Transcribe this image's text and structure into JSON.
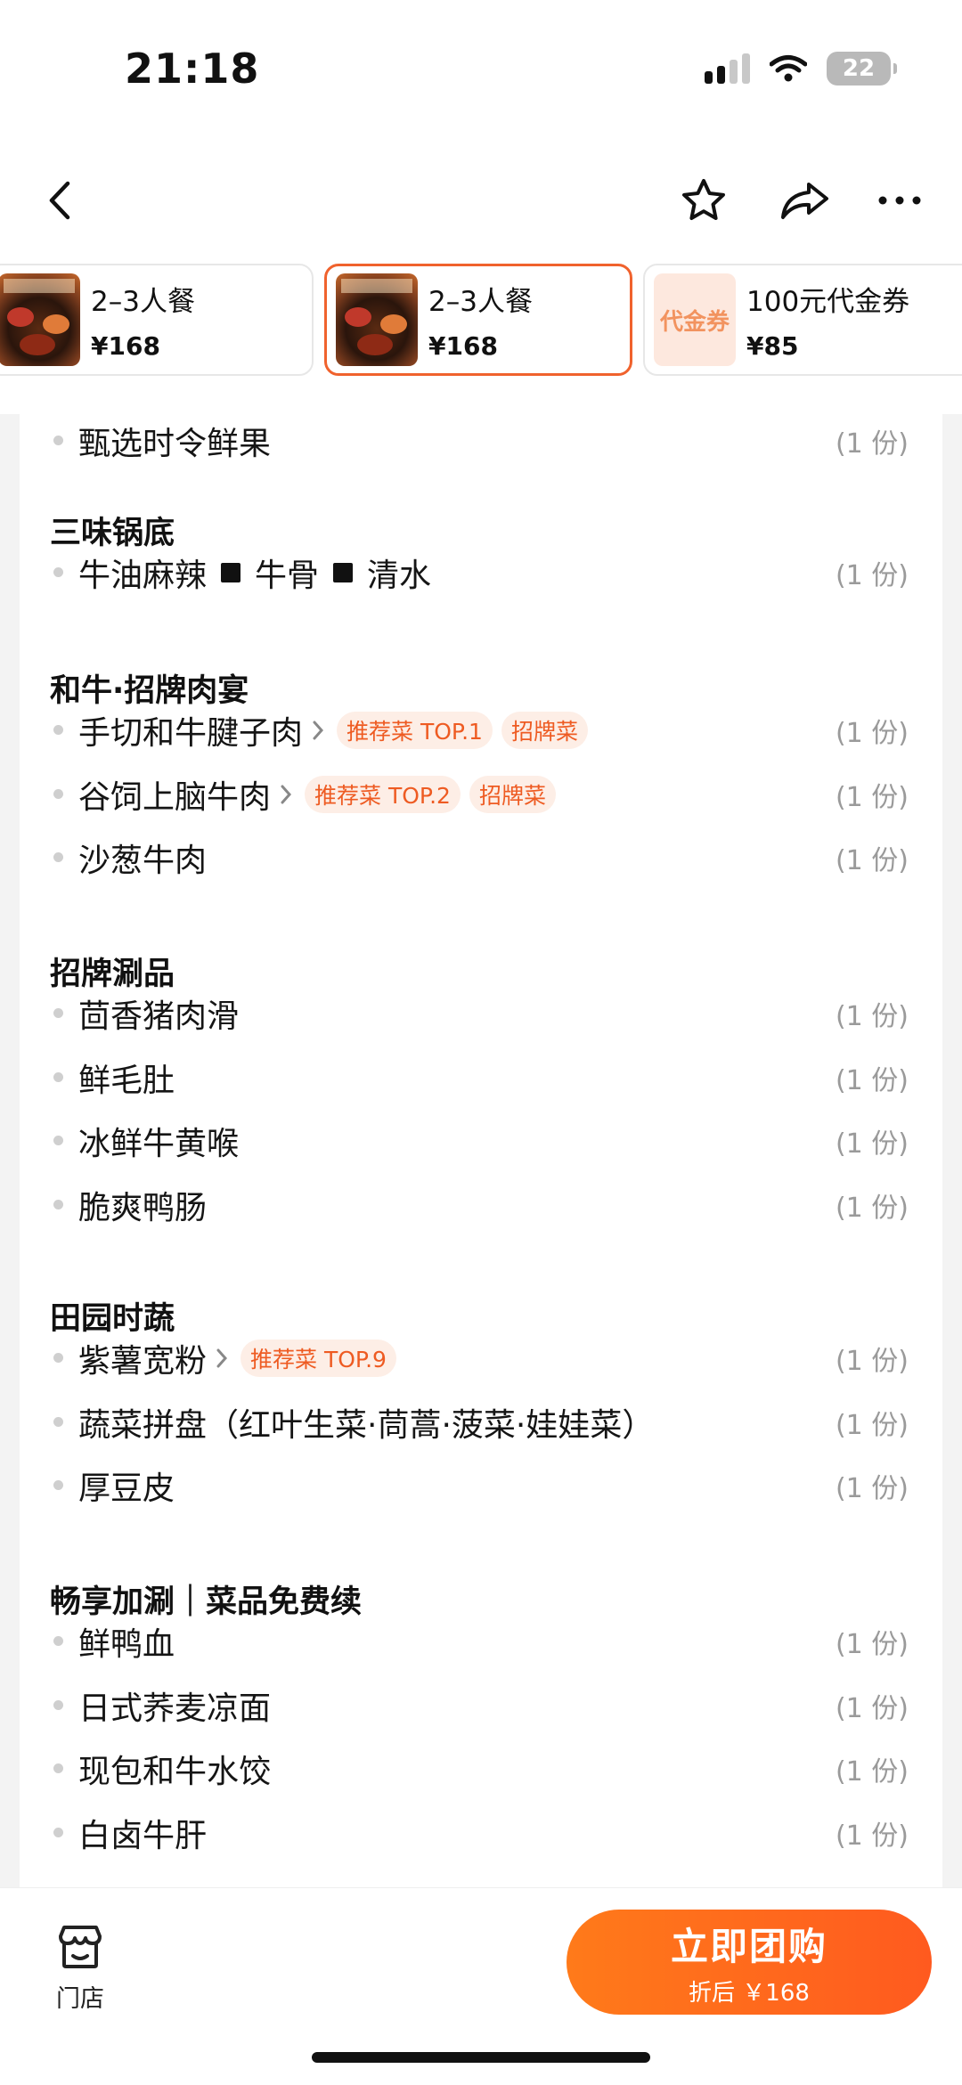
{
  "status_bar": {
    "time": "21:18",
    "battery": "22"
  },
  "nav": {
    "back": "back",
    "favorite": "star",
    "share": "share",
    "more": "more"
  },
  "packages": [
    {
      "name": "2–3人餐",
      "price": "¥168",
      "thumb": "hotpot-photo"
    },
    {
      "name": "2–3人餐",
      "price": "¥168",
      "thumb": "hotpot-photo",
      "active": true
    },
    {
      "name": "100元代金券",
      "price": "¥85",
      "thumb_text": "代金券"
    }
  ],
  "menu": {
    "top_item": {
      "name": "甄选时令鲜果",
      "qty": "(1 份)"
    },
    "sections": [
      {
        "title": "三味锅底",
        "items": [
          {
            "parts": [
              "牛油麻辣",
              "牛骨",
              "清水"
            ],
            "qty": "(1 份)"
          }
        ]
      },
      {
        "title": "和牛·招牌肉宴",
        "items": [
          {
            "name": "手切和牛腱子肉",
            "tags": [
              "推荐菜 TOP.1",
              "招牌菜"
            ],
            "qty": "(1 份)"
          },
          {
            "name": "谷饲上脑牛肉",
            "tags": [
              "推荐菜 TOP.2",
              "招牌菜"
            ],
            "qty": "(1 份)"
          },
          {
            "name": "沙葱牛肉",
            "qty": "(1 份)"
          }
        ]
      },
      {
        "title": "招牌涮品",
        "items": [
          {
            "name": "茴香猪肉滑",
            "qty": "(1 份)"
          },
          {
            "name": "鲜毛肚",
            "qty": "(1 份)"
          },
          {
            "name": "冰鲜牛黄喉",
            "qty": "(1 份)"
          },
          {
            "name": "脆爽鸭肠",
            "qty": "(1 份)"
          }
        ]
      },
      {
        "title": "田园时蔬",
        "items": [
          {
            "name": "紫薯宽粉",
            "tags": [
              "推荐菜 TOP.9"
            ],
            "qty": "(1 份)"
          },
          {
            "name": "蔬菜拼盘（红叶生菜·茼蒿·菠菜·娃娃菜）",
            "qty": "(1 份)"
          },
          {
            "name": "厚豆皮",
            "qty": "(1 份)"
          }
        ]
      },
      {
        "title": "畅享加涮｜菜品免费续",
        "items": [
          {
            "name": "鲜鸭血",
            "qty": "(1 份)"
          },
          {
            "name": "日式荞麦凉面",
            "qty": "(1 份)"
          },
          {
            "name": "现包和牛水饺",
            "qty": "(1 份)"
          },
          {
            "name": "白卤牛肝",
            "qty": "(1 份)"
          }
        ]
      }
    ]
  },
  "bottom_bar": {
    "store_label": "门店",
    "buy_label": "立即团购",
    "buy_sub": "折后 ￥168"
  },
  "colors": {
    "accent": "#f0622d",
    "tag_bg": "#fdeee6",
    "tag_text": "#ee5b22"
  }
}
